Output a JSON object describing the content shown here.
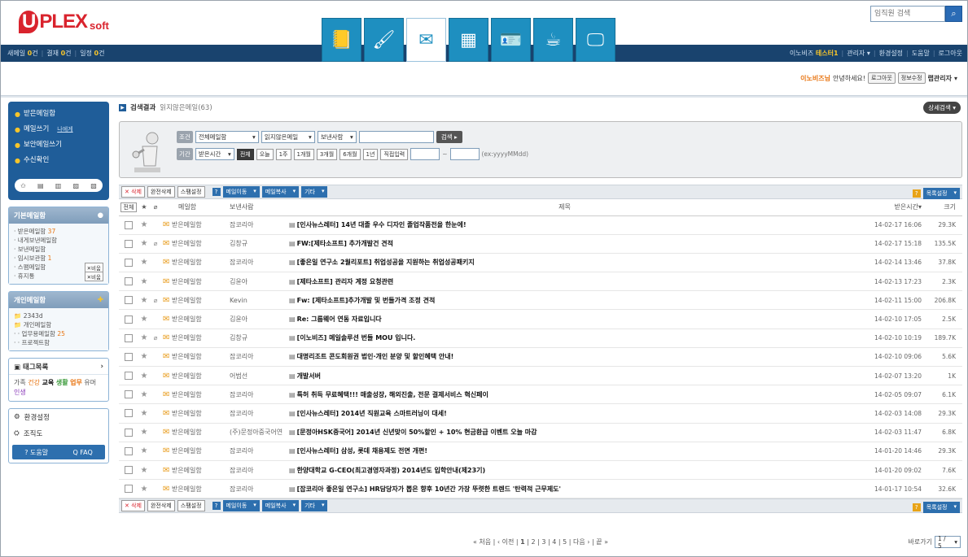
{
  "header": {
    "logo": {
      "mark": "U",
      "name": "PLEX",
      "suffix": "soft"
    },
    "search": {
      "placeholder": "임직원 검색",
      "icon": "search-icon"
    }
  },
  "navbar": {
    "left": [
      {
        "label": "새메일",
        "count": "0",
        "unit": "건"
      },
      {
        "label": "결재",
        "count": "0",
        "unit": "건"
      },
      {
        "label": "일정",
        "count": "0",
        "unit": "건"
      }
    ],
    "right": {
      "company": "이노비즈",
      "user": "테스터1",
      "items": [
        "관리자 ▾",
        "환경설정",
        "도움말",
        "로그아웃"
      ]
    }
  },
  "apps": [
    {
      "name": "notebook-icon",
      "glyph": "📒"
    },
    {
      "name": "brush-icon",
      "glyph": "🖌"
    },
    {
      "name": "mail-icon",
      "glyph": "✉"
    },
    {
      "name": "calendar-icon",
      "glyph": "▦"
    },
    {
      "name": "contact-card-icon",
      "glyph": "🪪"
    },
    {
      "name": "coffee-icon",
      "glyph": "☕"
    },
    {
      "name": "presentation-icon",
      "glyph": "🖵"
    }
  ],
  "welcome": {
    "company": "이노비즈님",
    "greeting": "안녕하세요!",
    "logout": "로그아웃",
    "info": "정보수정",
    "role": "랩관리자"
  },
  "sidebar": {
    "mail_menu": [
      "받은메일함",
      "메일쓰기",
      "보안메일쓰기",
      "수신확인"
    ],
    "mine_label": "나에게",
    "quick_icons": [
      "✩",
      "▤",
      "▥",
      "▨",
      "▧"
    ],
    "basic": {
      "title": "기본메일함",
      "items": [
        {
          "label": "받은메일함",
          "count": "37"
        },
        {
          "label": "내게보낸메일함",
          "count": ""
        },
        {
          "label": "보낸메일함",
          "count": ""
        },
        {
          "label": "임시보관함",
          "count": "1"
        },
        {
          "label": "스팸메일함",
          "btn": "비움"
        },
        {
          "label": "휴지통",
          "btn": "비움"
        }
      ]
    },
    "personal": {
      "title": "개인메일함",
      "items": [
        {
          "label": "2343d",
          "count": ""
        },
        {
          "label": "개인메일함",
          "count": ""
        },
        {
          "label": "· 업무용메일함",
          "count": "25"
        },
        {
          "label": "· 프로젝트함",
          "count": ""
        }
      ]
    },
    "tags": {
      "title": "태그목록",
      "words": [
        {
          "t": "가족",
          "c": "#555"
        },
        {
          "t": "건강",
          "c": "#e8730f"
        },
        {
          "t": "교육",
          "c": "#111"
        },
        {
          "t": "생활",
          "c": "#3a9a3a"
        },
        {
          "t": "업무",
          "c": "#e8730f"
        },
        {
          "t": "유머",
          "c": "#555"
        },
        {
          "t": "인생",
          "c": "#8a3ab9"
        }
      ]
    },
    "settings": [
      "환경설정",
      "조직도"
    ],
    "help": [
      "? 도움말",
      "Q FAQ"
    ]
  },
  "main": {
    "crumb": {
      "title": "검색결과",
      "sub": "읽지않은메일(63)"
    },
    "detail_btn": "상세검색 ▾",
    "search": {
      "cond_label": "조건",
      "sel_all": "전체메일함",
      "sel_unread": "읽지않은메일",
      "sel_sender": "보낸사람",
      "go": "검색",
      "period_label": "기간",
      "sel_period": "받은시간",
      "periods": [
        "전체",
        "오늘",
        "1주",
        "1개월",
        "3개월",
        "6개월",
        "1년",
        "직접입력"
      ],
      "format_hint": "(ex:yyyyMMdd)"
    },
    "toolbar": {
      "buttons": [
        "✕ 삭제",
        "완전삭제",
        "스팸설정"
      ],
      "dropdowns": [
        "메일이동",
        "메일복사",
        "기타"
      ],
      "right": "목록설정"
    },
    "columns": [
      "전체",
      "메일함",
      "보낸사람",
      "제목",
      "받은시간▾",
      "크기"
    ],
    "rows": [
      {
        "box": "받은메일함",
        "from": "잡코리아",
        "subject": "[인사뉴스레터] 14년 대졸 우수 디자인 졸업작품전을 한눈에!",
        "date": "14-02-17 16:06",
        "size": "29.3K",
        "clip": false
      },
      {
        "box": "받은메일함",
        "from": "김창규",
        "subject": "FW:[제타소프트] 추가개발건 견적",
        "date": "14-02-17 15:18",
        "size": "135.5K",
        "clip": true
      },
      {
        "box": "받은메일함",
        "from": "잡코리아",
        "subject": "[좋은일 연구소 2월리포트] 취업성공을 지원하는 취업성공패키지",
        "date": "14-02-14 13:46",
        "size": "37.8K",
        "clip": false
      },
      {
        "box": "받은메일함",
        "from": "김윤아",
        "subject": "[제타소프트] 관리자 계정 요청관련",
        "date": "14-02-13 17:23",
        "size": "2.3K",
        "clip": false
      },
      {
        "box": "받은메일함",
        "from": "Kevin",
        "subject": "Fw: [제타소프트]추가개발 및 번들가격 조정 견적",
        "date": "14-02-11 15:00",
        "size": "206.8K",
        "clip": true
      },
      {
        "box": "받은메일함",
        "from": "김윤아",
        "subject": "Re: 그룹웨어 연동 자료입니다",
        "date": "14-02-10 17:05",
        "size": "2.5K",
        "clip": false
      },
      {
        "box": "받은메일함",
        "from": "김창규",
        "subject": "[이노비즈] 메일솔루션 번들 MOU 입니다.",
        "date": "14-02-10 10:19",
        "size": "189.7K",
        "clip": true
      },
      {
        "box": "받은메일함",
        "from": "잡코리아",
        "subject": "대명리조트 콘도회원권 법인·개인 분양 및 할인혜택 안내!",
        "date": "14-02-10 09:06",
        "size": "5.6K",
        "clip": false
      },
      {
        "box": "받은메일함",
        "from": "어범선",
        "subject": "개발서버",
        "date": "14-02-07 13:20",
        "size": "1K",
        "clip": false
      },
      {
        "box": "받은메일함",
        "from": "잡코리아",
        "subject": "특허 취득 무료혜택!!! 매출성장, 해외진출, 전문 결제서비스 혁신페이",
        "date": "14-02-05 09:07",
        "size": "6.1K",
        "clip": false
      },
      {
        "box": "받은메일함",
        "from": "잡코리아",
        "subject": "[인사뉴스레터] 2014년 직원교육 스마트러닝이 대세!",
        "date": "14-02-03 14:08",
        "size": "29.3K",
        "clip": false
      },
      {
        "box": "받은메일함",
        "from": "(주)문정아중국어연...",
        "subject": "[문정아HSK중국어] 2014년 신년맞이 50%할인 + 10% 현금환급 이벤트 오늘 마감",
        "date": "14-02-03 11:47",
        "size": "6.8K",
        "clip": false
      },
      {
        "box": "받은메일함",
        "from": "잡코리아",
        "subject": "[인사뉴스레터] 삼성, 롯데 채용제도 전면 개편!",
        "date": "14-01-20 14:46",
        "size": "29.3K",
        "clip": false
      },
      {
        "box": "받은메일함",
        "from": "잡코리아",
        "subject": "한양대학교 G-CEO(최고경영자과정) 2014년도 입학안내(제23기)",
        "date": "14-01-20 09:02",
        "size": "7.6K",
        "clip": false
      },
      {
        "box": "받은메일함",
        "from": "잡코리아",
        "subject": "[잡코리아 좋은일 연구소] HR담당자가 뽑은 향후 10년간 가장 뚜렷한 트렌드 '탄력적 근무제도'",
        "date": "14-01-17 10:54",
        "size": "32.6K",
        "clip": false
      }
    ],
    "pager": {
      "first": "« 처음",
      "prev": "‹ 이전",
      "pages": [
        "1",
        "2",
        "3",
        "4",
        "5"
      ],
      "next": "다음 ›",
      "last": "끝 »"
    },
    "goto": {
      "label": "바로가기",
      "value": "1 / 5"
    }
  }
}
